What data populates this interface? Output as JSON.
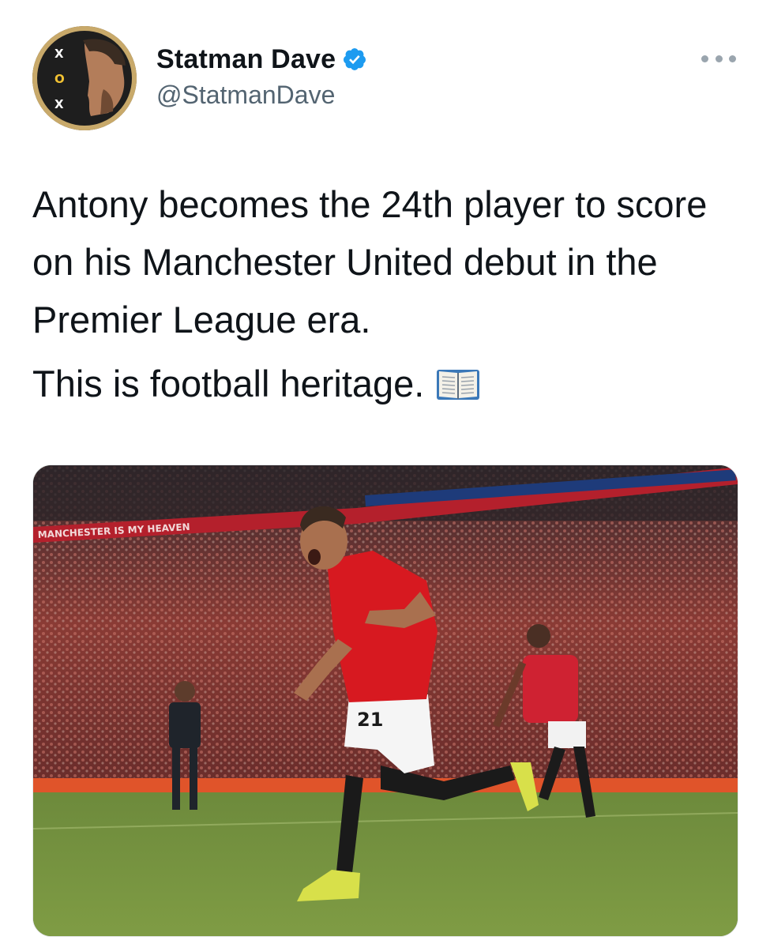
{
  "author": {
    "display_name": "Statman Dave",
    "handle": "@StatmanDave",
    "verified": true,
    "avatar_icon": "statman-avatar-icon",
    "avatar_marks": [
      "X",
      "O",
      "X"
    ]
  },
  "tweet": {
    "paragraphs": [
      "Antony becomes the 24th player to score on his Manchester United debut in the Premier League era.",
      "This is football heritage."
    ],
    "emoji_icon": "open-book-emoji"
  },
  "media": {
    "description_icon": "football-celebration-photo",
    "banner_text": "MANCHESTER IS MY HEAVEN",
    "shirt_number": "21"
  },
  "icons": {
    "verified_badge": "verified-badge-icon",
    "more": "more-options-icon"
  },
  "colors": {
    "verified_blue": "#1d9bf0",
    "text": "#0f1419",
    "secondary_text": "#536471",
    "united_red": "#d71920"
  }
}
